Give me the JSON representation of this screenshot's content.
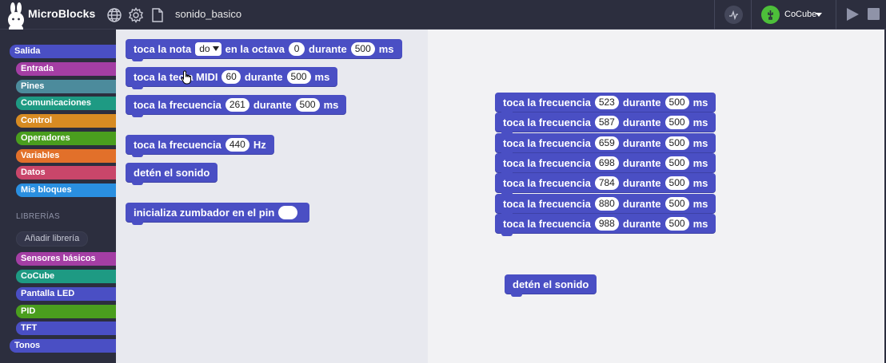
{
  "app": {
    "title": "MicroBlocks",
    "project_name": "sonido_basico",
    "board_name": "CoCube",
    "icons": [
      "globe-icon",
      "gear-icon",
      "file-icon",
      "graph-icon",
      "start-icon",
      "stop-icon"
    ]
  },
  "sidebar": {
    "categories": [
      {
        "label": "Salida",
        "color": "#4a4fc4"
      },
      {
        "label": "Entrada",
        "color": "#a43ea4"
      },
      {
        "label": "Pines",
        "color": "#4c8b9c"
      },
      {
        "label": "Comunicaciones",
        "color": "#1e9a83"
      },
      {
        "label": "Control",
        "color": "#d78b22"
      },
      {
        "label": "Operadores",
        "color": "#4a9e1e"
      },
      {
        "label": "Variables",
        "color": "#e2702a"
      },
      {
        "label": "Datos",
        "color": "#c9466a"
      },
      {
        "label": "Mis bloques",
        "color": "#2a8fe0"
      }
    ],
    "libraries_heading": "LIBRERÍAS",
    "add_library_label": "Añadir librería",
    "libraries": [
      {
        "label": "Sensores básicos",
        "color": "#a43ea4"
      },
      {
        "label": "CoCube",
        "color": "#1e9a83"
      },
      {
        "label": "Pantalla LED",
        "color": "#4a4fc4"
      },
      {
        "label": "PID",
        "color": "#4a9e1e"
      },
      {
        "label": "TFT",
        "color": "#4a4fc4"
      },
      {
        "label": "Tonos",
        "color": "#4a4fc4"
      }
    ]
  },
  "palette": {
    "play_note": {
      "w1": "toca la nota",
      "note": "do",
      "w2": "en la octava",
      "octave": "0",
      "w3": "durante",
      "ms": "500",
      "w4": "ms"
    },
    "play_midi": {
      "w1": "toca la tecla MIDI",
      "key": "60",
      "w2": "durante",
      "ms": "500",
      "w3": "ms"
    },
    "play_freq": {
      "w1": "toca la frecuencia",
      "freq": "261",
      "w2": "durante",
      "ms": "500",
      "w3": "ms"
    },
    "start_tone": {
      "w1": "toca la frecuencia",
      "freq": "440",
      "w2": "Hz"
    },
    "stop_tone": {
      "w1": "detén el sonido"
    },
    "init_buzzer": {
      "w1": "inicializa zumbador en el pin",
      "pin": ""
    }
  },
  "script": {
    "words": {
      "w1": "toca la frecuencia",
      "w2": "durante",
      "w3": "ms"
    },
    "notes": [
      {
        "freq": "523",
        "ms": "500"
      },
      {
        "freq": "587",
        "ms": "500"
      },
      {
        "freq": "659",
        "ms": "500"
      },
      {
        "freq": "698",
        "ms": "500"
      },
      {
        "freq": "784",
        "ms": "500"
      },
      {
        "freq": "880",
        "ms": "500"
      },
      {
        "freq": "988",
        "ms": "500"
      }
    ],
    "stop_block": "detén el sonido"
  }
}
